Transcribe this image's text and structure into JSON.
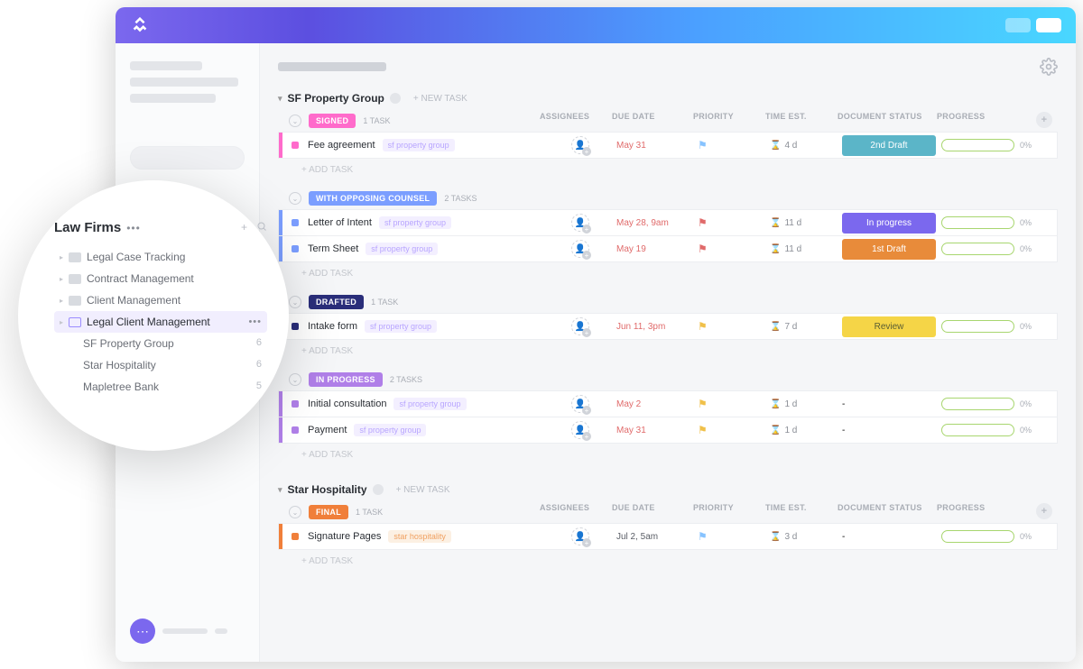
{
  "header": {
    "logo": "clickup"
  },
  "popover": {
    "title": "Law Firms",
    "items": [
      {
        "label": "Legal Case Tracking"
      },
      {
        "label": "Contract Management"
      },
      {
        "label": "Client Management"
      },
      {
        "label": "Legal Client Management",
        "selected": true
      }
    ],
    "subitems": [
      {
        "label": "SF Property Group",
        "count": "6"
      },
      {
        "label": "Star Hospitality",
        "count": "6"
      },
      {
        "label": "Mapletree Bank",
        "count": "5"
      }
    ]
  },
  "columns": {
    "assignees": "ASSIGNEES",
    "due": "DUE DATE",
    "priority": "PRIORITY",
    "time": "TIME EST.",
    "doc": "DOCUMENT STATUS",
    "prog": "PROGRESS"
  },
  "new_task": "+ NEW TASK",
  "add_task": "+ ADD TASK",
  "sections": [
    {
      "title": "SF Property Group",
      "groups": [
        {
          "status": "SIGNED",
          "status_color": "#ff6bcb",
          "accent": "#ff6bcb",
          "count": "1 TASK",
          "tasks": [
            {
              "name": "Fee agreement",
              "tag": "sf property group",
              "due": "May 31",
              "flag": "#87c3ff",
              "time": "4 d",
              "doc": {
                "label": "2nd Draft",
                "bg": "#5bb5c8"
              },
              "prog": "0%"
            }
          ]
        },
        {
          "status": "WITH OPPOSING COUNSEL",
          "status_color": "#7b9eff",
          "accent": "#7b9eff",
          "count": "2 TASKS",
          "tasks": [
            {
              "name": "Letter of Intent",
              "tag": "sf property group",
              "due": "May 28, 9am",
              "flag": "#e06a6a",
              "time": "11 d",
              "doc": {
                "label": "In progress",
                "bg": "#7B68EE"
              },
              "prog": "0%"
            },
            {
              "name": "Term Sheet",
              "tag": "sf property group",
              "due": "May 19",
              "flag": "#e06a6a",
              "time": "11 d",
              "doc": {
                "label": "1st Draft",
                "bg": "#e88b3a"
              },
              "prog": "0%"
            }
          ]
        },
        {
          "status": "DRAFTED",
          "status_color": "#2a2e7a",
          "accent": "#2a2e7a",
          "count": "1 TASK",
          "tasks": [
            {
              "name": "Intake form",
              "tag": "sf property group",
              "due": "Jun 11, 3pm",
              "flag": "#f0c04a",
              "time": "7 d",
              "doc": {
                "label": "Review",
                "bg": "#f5d547",
                "fg": "#5a5e34"
              },
              "prog": "0%"
            }
          ]
        },
        {
          "status": "IN PROGRESS",
          "status_color": "#b07fe8",
          "accent": "#b07fe8",
          "count": "2 TASKS",
          "tasks": [
            {
              "name": "Initial consultation",
              "tag": "sf property group",
              "due": "May 2",
              "flag": "#f0c04a",
              "time": "1 d",
              "doc": {
                "label": "-",
                "plain": true
              },
              "prog": "0%"
            },
            {
              "name": "Payment",
              "tag": "sf property group",
              "due": "May 31",
              "flag": "#f0c04a",
              "time": "1 d",
              "doc": {
                "label": "-",
                "plain": true
              },
              "prog": "0%"
            }
          ]
        }
      ]
    },
    {
      "title": "Star Hospitality",
      "groups": [
        {
          "status": "FINAL",
          "status_color": "#f07f3a",
          "accent": "#f07f3a",
          "count": "1 TASK",
          "tasks": [
            {
              "name": "Signature Pages",
              "tag": "star hospitality",
              "tag_variant": "orange",
              "due": "Jul 2, 5am",
              "due_nored": true,
              "flag": "#87c3ff",
              "time": "3 d",
              "doc": {
                "label": "-",
                "plain": true
              },
              "prog": "0%"
            }
          ]
        }
      ]
    }
  ]
}
